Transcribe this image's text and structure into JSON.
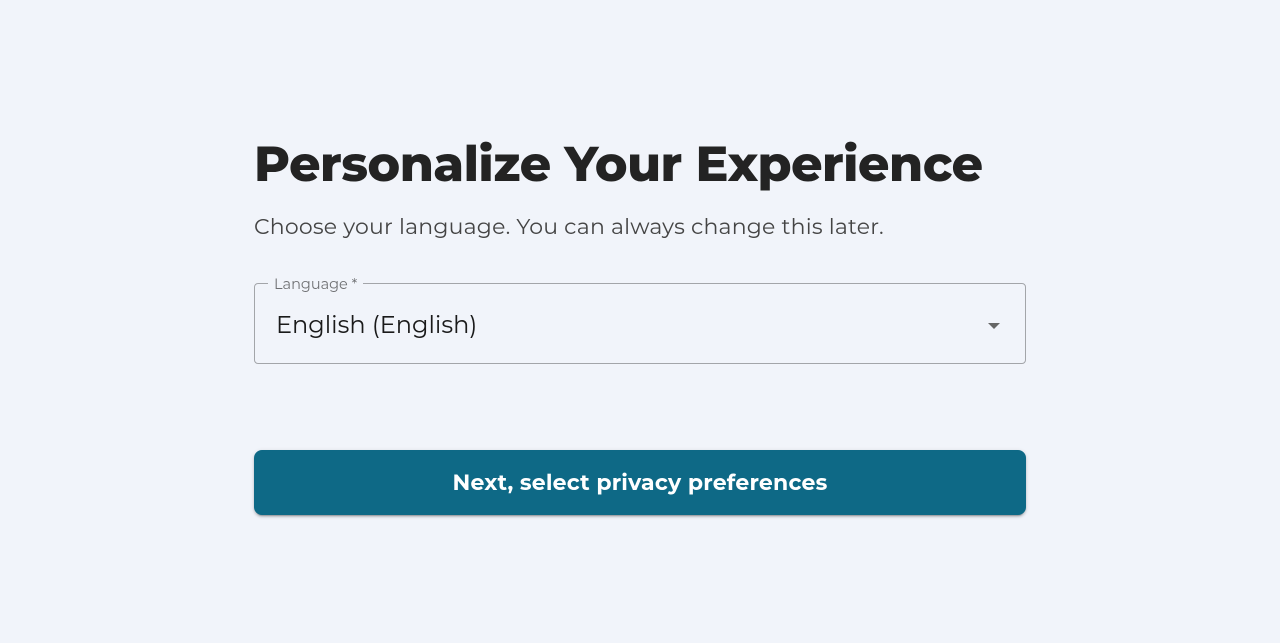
{
  "header": {
    "title": "Personalize Your Experience",
    "subtitle": "Choose your language. You can always change this later."
  },
  "form": {
    "language": {
      "label": "Language *",
      "selected": "English (English)"
    }
  },
  "actions": {
    "next_label": "Next, select privacy preferences"
  }
}
